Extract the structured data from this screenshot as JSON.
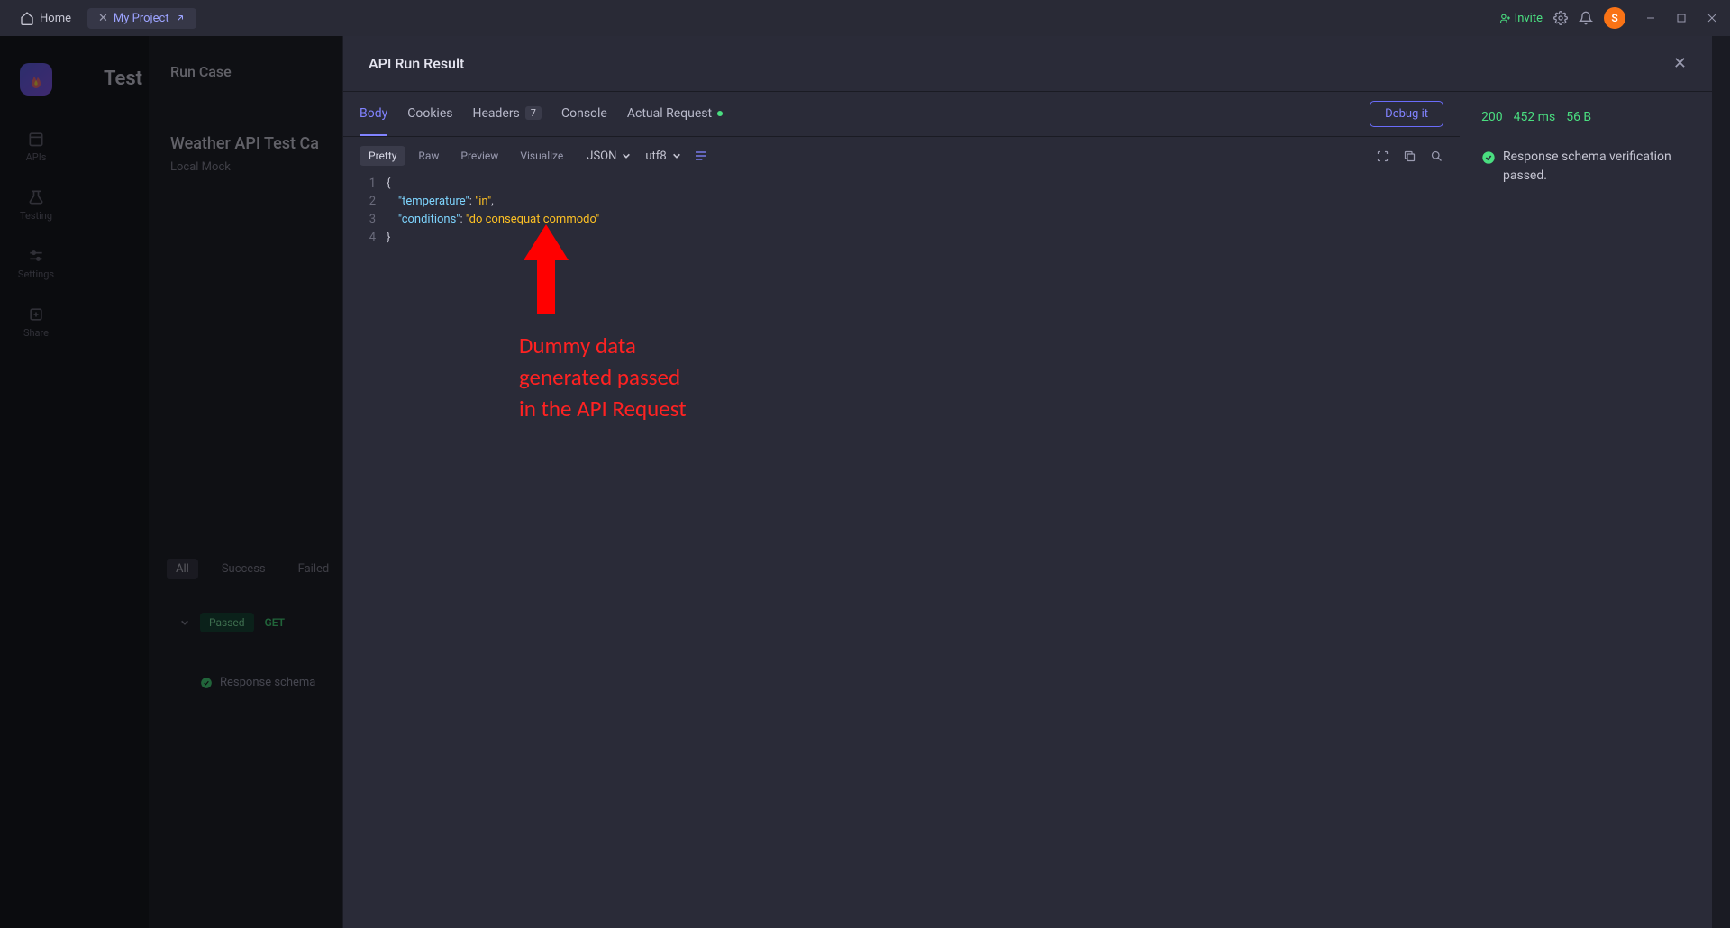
{
  "topbar": {
    "home_label": "Home",
    "project_label": "My Project",
    "invite_label": "Invite",
    "avatar_initial": "S"
  },
  "rail": {
    "apis": "APIs",
    "testing": "Testing",
    "settings": "Settings",
    "share": "Share"
  },
  "left_content": {
    "test_title": "Test",
    "runcase_title": "Run Case",
    "case_name": "Weather API Test Ca",
    "mock_label": "Local Mock",
    "filters": {
      "all": "All",
      "success": "Success",
      "failed": "Failed"
    },
    "result_badge": "Passed",
    "method": "GET",
    "schema_row_text": "Response schema"
  },
  "modal": {
    "title": "API Run Result",
    "tabs": {
      "body": "Body",
      "cookies": "Cookies",
      "headers": "Headers",
      "headers_count": "7",
      "console": "Console",
      "actual_request": "Actual Request"
    },
    "debug_button": "Debug it",
    "format_buttons": {
      "pretty": "Pretty",
      "raw": "Raw",
      "preview": "Preview",
      "visualize": "Visualize"
    },
    "format_select": "JSON",
    "encoding_select": "utf8",
    "code": {
      "line1": "{",
      "line2_key": "\"temperature\"",
      "line2_val": "\"in\"",
      "line3_key": "\"conditions\"",
      "line3_val": "\"do consequat commodo\"",
      "line4": "}"
    }
  },
  "side_panel": {
    "status_code": "200",
    "time": "452 ms",
    "size": "56 B",
    "schema_message": "Response schema verification passed."
  },
  "annotation": {
    "text": "Dummy data generated passed in the API Request"
  }
}
